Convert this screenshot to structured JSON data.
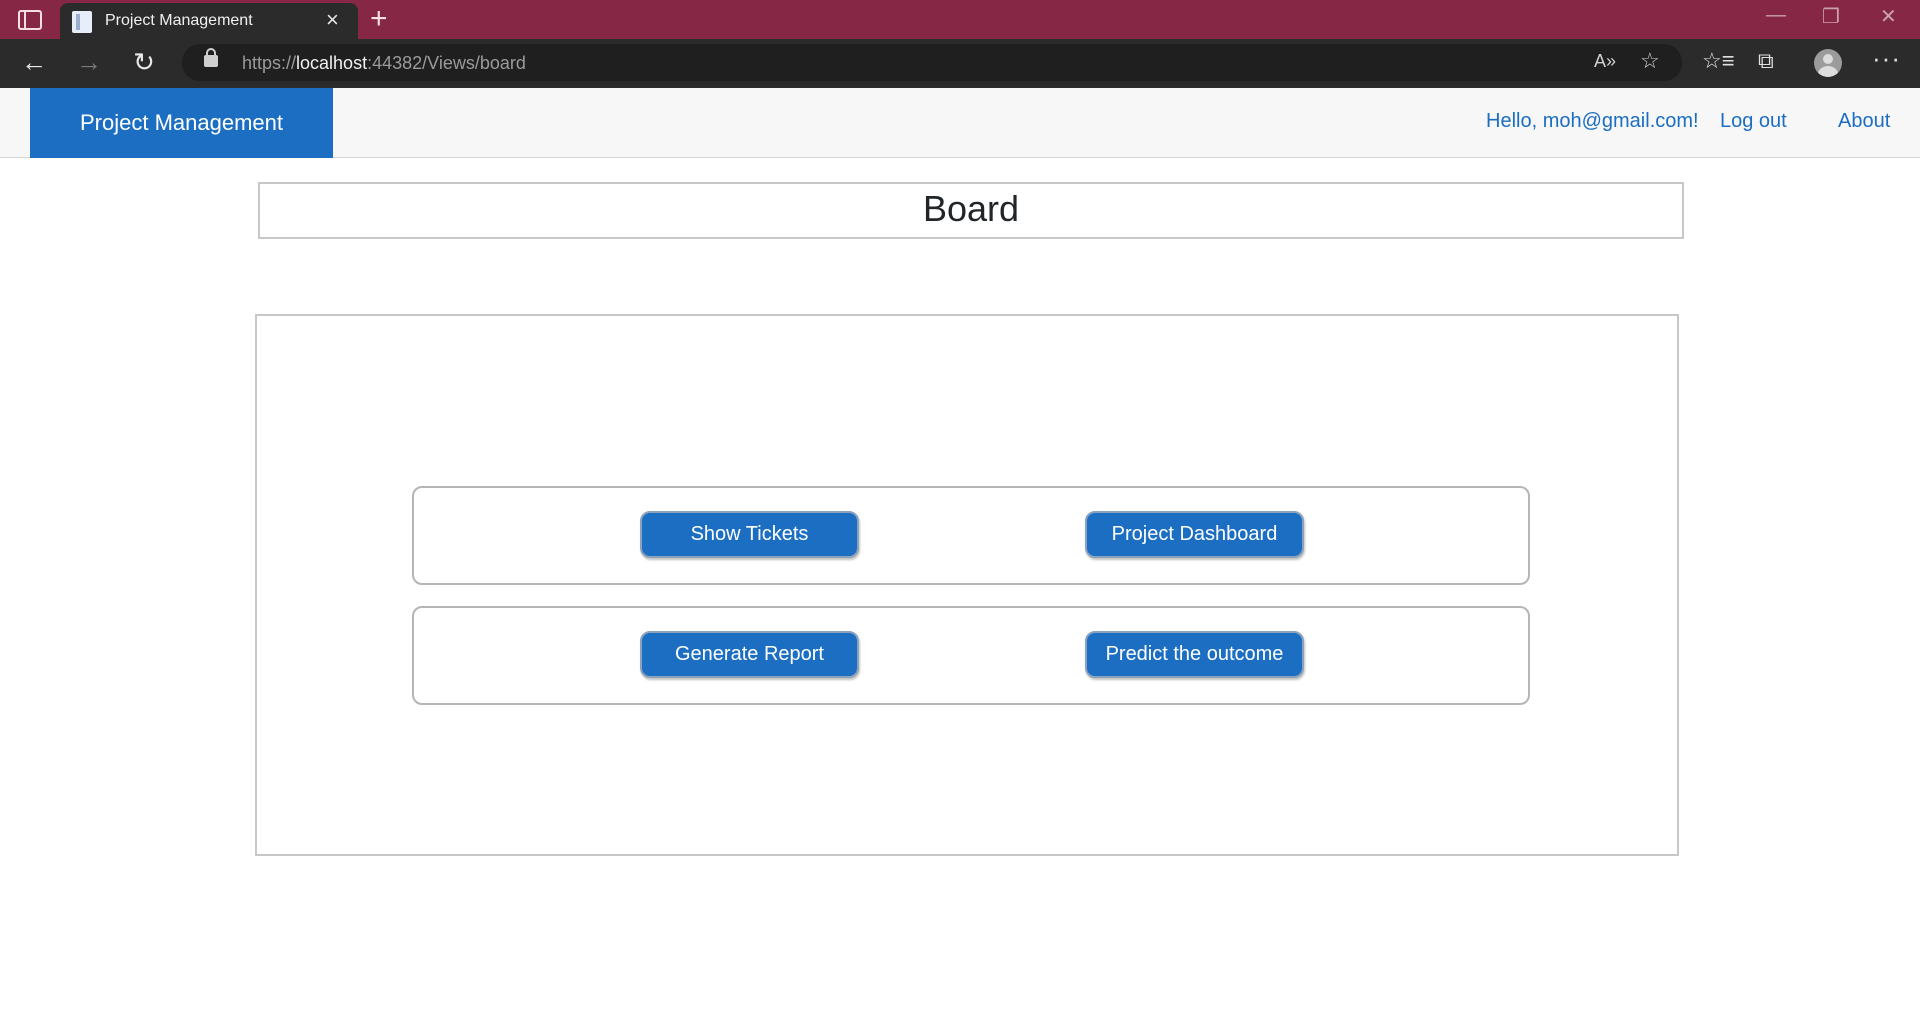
{
  "browser": {
    "tab_title": "Project Management",
    "tab_close": "×",
    "new_tab": "+",
    "url_scheme": "https://",
    "url_host": "localhost",
    "url_path": ":44382/Views/board",
    "icons": {
      "tab_actions": "tab-actions-icon",
      "back": "back-arrow-icon",
      "forward": "forward-arrow-icon",
      "refresh": "refresh-icon",
      "lock": "lock-icon",
      "read_aloud": "read-aloud-icon",
      "favorite": "favorite-add-icon",
      "favorites": "favorites-icon",
      "collections": "collections-icon",
      "profile": "profile-icon",
      "more": "more-icon"
    },
    "glyphs": {
      "back": "←",
      "forward": "→",
      "refresh": "↻",
      "read_aloud": "A»",
      "favorite": "☆",
      "favorites": "☆≡",
      "collections": "⧉",
      "more": "···",
      "minimize": "—",
      "restore": "❐",
      "close": "✕"
    }
  },
  "navbar": {
    "brand": "Project Management",
    "greeting": "Hello, moh@gmail.com!",
    "logout": "Log out",
    "about": "About"
  },
  "page": {
    "title": "Board",
    "actions": {
      "show_tickets": "Show Tickets",
      "project_dashboard": "Project Dashboard",
      "generate_report": "Generate Report",
      "predict_outcome": "Predict the outcome"
    }
  },
  "colors": {
    "tabstrip": "#862745",
    "toolbar": "#2b2b2b",
    "brand_blue": "#1b6ec2",
    "navbar_bg": "#f7f7f7"
  }
}
